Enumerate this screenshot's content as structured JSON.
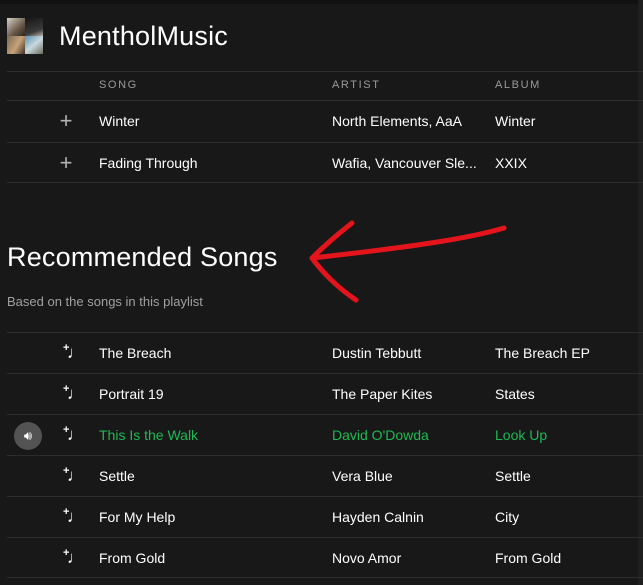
{
  "app": {
    "title": "MentholMusic"
  },
  "table": {
    "headers": {
      "song": "SONG",
      "artist": "ARTIST",
      "album": "ALBUM"
    },
    "rows": [
      {
        "song": "Winter",
        "artist": "North Elements, AaA",
        "album": "Winter"
      },
      {
        "song": "Fading Through",
        "artist": "Wafia, Vancouver Sle...",
        "album": "XXIX"
      }
    ]
  },
  "recommended": {
    "title": "Recommended Songs",
    "subtitle": "Based on the songs in this playlist",
    "rows": [
      {
        "song": "The Breach",
        "artist": "Dustin Tebbutt",
        "album": "The Breach EP"
      },
      {
        "song": "Portrait 19",
        "artist": "The Paper Kites",
        "album": "States"
      },
      {
        "song": "This Is the Walk",
        "artist": "David O'Dowda",
        "album": "Look Up"
      },
      {
        "song": "Settle",
        "artist": "Vera Blue",
        "album": "Settle"
      },
      {
        "song": "For My Help",
        "artist": "Hayden Calnin",
        "album": "City"
      },
      {
        "song": "From Gold",
        "artist": "Novo Amor",
        "album": "From Gold"
      }
    ],
    "playing_index": 2
  },
  "colors": {
    "background": "#181818",
    "playing": "#1db954",
    "annotation_arrow": "#e3141b"
  },
  "icons": {
    "add": "plus-icon",
    "add_song": "add-song-icon",
    "playing": "speaker-icon"
  }
}
